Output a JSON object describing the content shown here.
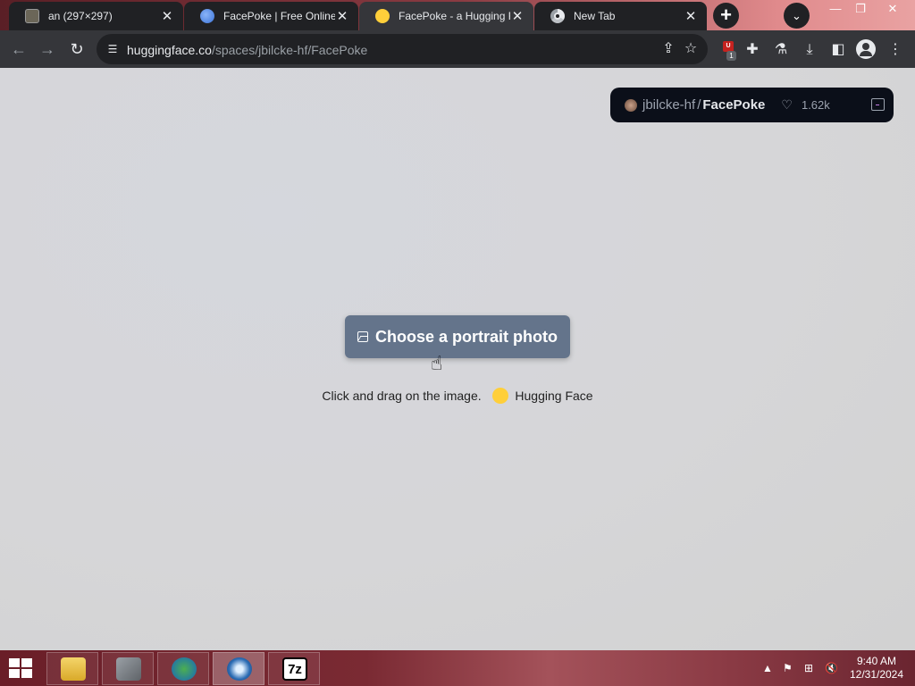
{
  "browser": {
    "tabs": [
      {
        "title": "an (297×297)",
        "favicon": "image-favicon",
        "active": false
      },
      {
        "title": "FacePoke | Free Online A",
        "favicon": "globe-favicon",
        "active": false
      },
      {
        "title": "FacePoke - a Hugging F",
        "favicon": "hugging-face-favicon",
        "active": true
      },
      {
        "title": "New Tab",
        "favicon": "chrome-favicon",
        "active": false
      }
    ],
    "close_glyph": "✕",
    "new_tab_glyph": "+",
    "tab_search_glyph": "⌄",
    "window_controls": {
      "minimize": "—",
      "restore": "❐",
      "close": "✕"
    },
    "nav": {
      "back": "←",
      "forward": "→",
      "reload": "↻"
    },
    "url": {
      "host": "huggingface.co",
      "path": "/spaces/jbilcke-hf/FacePoke"
    },
    "extension_badge": "U",
    "extension_count": "1"
  },
  "space": {
    "owner": "jbilcke-hf",
    "separator": "/",
    "name": "FacePoke",
    "likes": "1.62k",
    "heart_glyph": "♡"
  },
  "main": {
    "choose_button_label": "Choose a portrait photo",
    "caption": "Click and drag on the image.",
    "credit": "Hugging Face"
  },
  "taskbar": {
    "time": "9:40 AM",
    "date": "12/31/2024",
    "apps": [
      "file-explorer",
      "sword-app",
      "internet-download-manager",
      "browser-app",
      "7-zip"
    ],
    "sevenzip_label": "7z"
  },
  "colors": {
    "accent_button": "#64748b",
    "space_badge_bg": "#0b0f19",
    "browser_frame": "#35363a"
  }
}
